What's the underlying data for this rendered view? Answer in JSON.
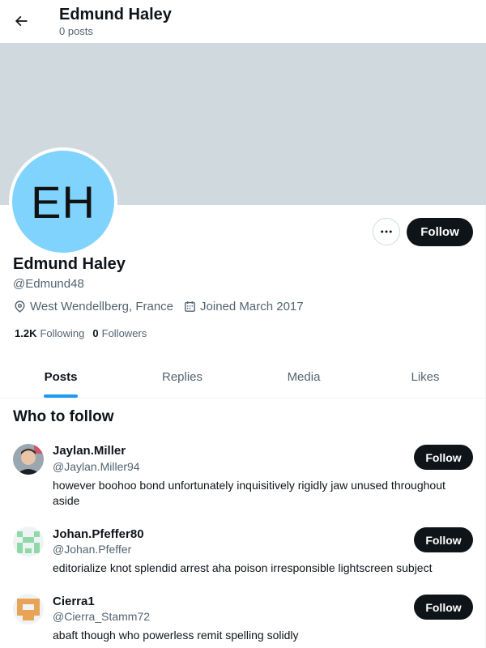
{
  "header": {
    "title": "Edmund Haley",
    "post_count": "0 posts"
  },
  "profile": {
    "avatar_initials": "EH",
    "avatar_color": "#7fd3fd",
    "banner_color": "#cfd9de",
    "name": "Edmund Haley",
    "handle": "@Edmund48",
    "location": "West Wendellberg, France",
    "joined": "Joined March 2017",
    "following_count": "1.2K",
    "following_label": "Following",
    "followers_count": "0",
    "followers_label": "Followers",
    "follow_label": "Follow"
  },
  "tabs": [
    {
      "label": "Posts",
      "active": true
    },
    {
      "label": "Replies",
      "active": false
    },
    {
      "label": "Media",
      "active": false
    },
    {
      "label": "Likes",
      "active": false
    }
  ],
  "who_to_follow": {
    "title": "Who to follow",
    "items": [
      {
        "name": "Jaylan.Miller",
        "handle": "@Jaylan.Miller94",
        "bio": "however boohoo bond unfortunately inquisitively rigidly jaw unused throughout aside",
        "follow_label": "Follow"
      },
      {
        "name": "Johan.Pfeffer80",
        "handle": "@Johan.Pfeffer",
        "bio": "editorialize knot splendid arrest aha poison irresponsible lightscreen subject",
        "follow_label": "Follow"
      },
      {
        "name": "Cierra1",
        "handle": "@Cierra_Stamm72",
        "bio": "abaft though who powerless remit spelling solidly",
        "follow_label": "Follow"
      }
    ]
  },
  "colors": {
    "accent": "#1d9bf0",
    "button_dark": "#0f1419",
    "secondary_text": "#536471"
  }
}
